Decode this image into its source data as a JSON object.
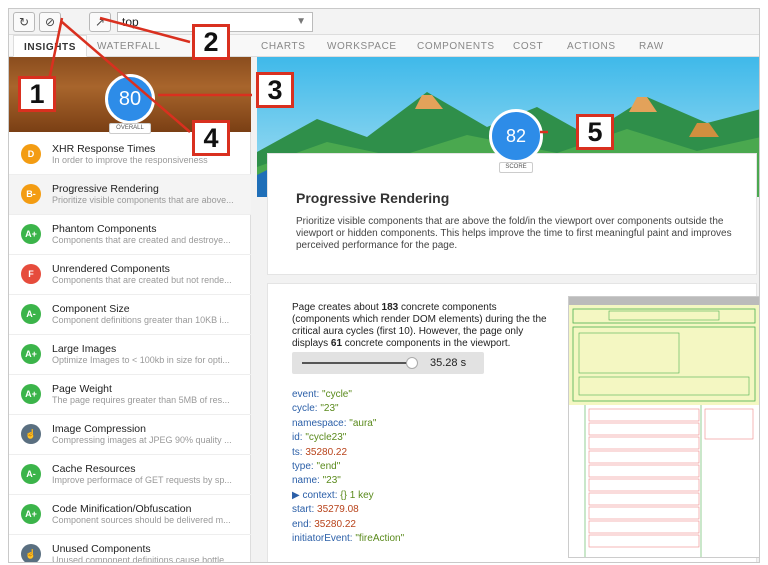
{
  "toolbar": {
    "refresh_icon": "refresh-icon",
    "clear_icon": "clear-icon",
    "popout_icon": "popout-icon",
    "frame_select": "top"
  },
  "tabs": [
    {
      "label": "INSIGHTS",
      "active": true
    },
    {
      "label": "WATERFALL"
    },
    {
      "label": "CHARTS"
    },
    {
      "label": "WORKSPACE"
    },
    {
      "label": "COMPONENTS"
    },
    {
      "label": "COST"
    },
    {
      "label": "ACTIONS"
    },
    {
      "label": "RAW"
    }
  ],
  "sidebar": {
    "overall_score": "80",
    "overall_label": "OVERALL",
    "items": [
      {
        "grade": "D",
        "color": "#f39c12",
        "title": "XHR Response Times",
        "desc": "In order to improve the responsiveness"
      },
      {
        "grade": "B-",
        "color": "#f39c12",
        "title": "Progressive Rendering",
        "desc": "Prioritize visible components that are above...",
        "selected": true
      },
      {
        "grade": "A+",
        "color": "#3bb44a",
        "title": "Phantom Components",
        "desc": "Components that are created and destroye..."
      },
      {
        "grade": "F",
        "color": "#e64c3c",
        "title": "Unrendered Components",
        "desc": "Components that are created but not rende..."
      },
      {
        "grade": "A-",
        "color": "#3bb44a",
        "title": "Component Size",
        "desc": "Component definitions greater than 10KB i..."
      },
      {
        "grade": "A+",
        "color": "#3bb44a",
        "title": "Large Images",
        "desc": "Optimize Images to < 100kb in size for opti..."
      },
      {
        "grade": "A+",
        "color": "#3bb44a",
        "title": "Page Weight",
        "desc": "The page requires greater than 5MB of res..."
      },
      {
        "grade": "☝",
        "color": "#5a6f80",
        "title": "Image Compression",
        "desc": "Compressing images at JPEG 90% quality ..."
      },
      {
        "grade": "A-",
        "color": "#3bb44a",
        "title": "Cache Resources",
        "desc": "Improve performace of GET requests by sp..."
      },
      {
        "grade": "A+",
        "color": "#3bb44a",
        "title": "Code Minification/Obfuscation",
        "desc": "Component sources should be delivered m..."
      },
      {
        "grade": "☝",
        "color": "#5a6f80",
        "title": "Unused Components",
        "desc": "Unused component definitions cause bottle..."
      }
    ]
  },
  "main": {
    "score": "82",
    "score_label": "SCORE",
    "title": "Progressive Rendering",
    "description": "Prioritize visible components that are above the fold/in the viewport over components outside the viewport or hidden components. This helps improve the time to first meaningful paint and improves perceived performance for the page.",
    "detail": {
      "text_1": "Page creates about ",
      "count_1": "183",
      "text_2": " concrete components (components which render DOM elements) during the the critical aura cycles (first 10). However, the page only displays ",
      "count_2": "61",
      "text_3": " concrete components in the viewport.",
      "time": "35.28 s",
      "props": [
        {
          "k": "event:",
          "v": "\"cycle\"",
          "t": "s"
        },
        {
          "k": "cycle:",
          "v": "\"23\"",
          "t": "s"
        },
        {
          "k": "namespace:",
          "v": "\"aura\"",
          "t": "s"
        },
        {
          "k": "id:",
          "v": "\"cycle23\"",
          "t": "s"
        },
        {
          "k": "ts:",
          "v": "35280.22",
          "t": "n"
        },
        {
          "k": "type:",
          "v": "\"end\"",
          "t": "s"
        },
        {
          "k": "name:",
          "v": "\"23\"",
          "t": "s"
        },
        {
          "k": "▶ context:",
          "v": "{}  1 key",
          "t": "s"
        },
        {
          "k": "start:",
          "v": "35279.08",
          "t": "n"
        },
        {
          "k": "end:",
          "v": "35280.22",
          "t": "n"
        },
        {
          "k": "initiatorEvent:",
          "v": "\"fireAction\"",
          "t": "s"
        }
      ]
    }
  },
  "callouts": [
    "1",
    "2",
    "3",
    "4",
    "5"
  ]
}
